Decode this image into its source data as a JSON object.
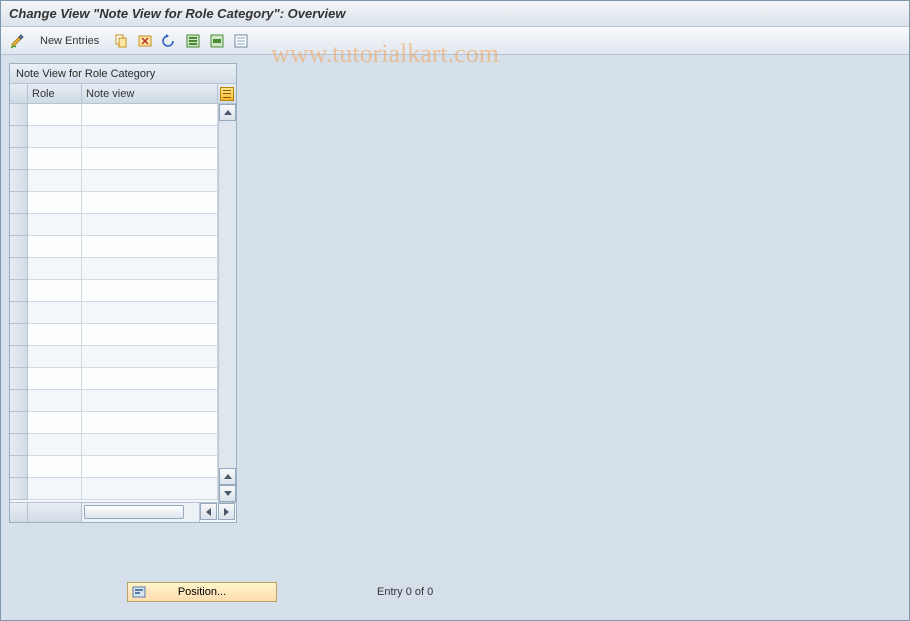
{
  "header": {
    "title": "Change View \"Note View for Role Category\": Overview"
  },
  "toolbar": {
    "edit_icon": "pencil-check",
    "new_entries_label": "New Entries",
    "btn_copy": "copy",
    "btn_delete": "delete",
    "btn_undo": "undo",
    "btn_select_all": "select-all",
    "btn_save": "save",
    "btn_deselect": "deselect-all"
  },
  "watermark": "www.tutorialkart.com",
  "panel": {
    "title": "Note View for Role Category",
    "columns": {
      "row_selector": "",
      "role": "Role",
      "note_view": "Note view",
      "config": ""
    },
    "rows": [
      {
        "role": "",
        "note_view": ""
      },
      {
        "role": "",
        "note_view": ""
      },
      {
        "role": "",
        "note_view": ""
      },
      {
        "role": "",
        "note_view": ""
      },
      {
        "role": "",
        "note_view": ""
      },
      {
        "role": "",
        "note_view": ""
      },
      {
        "role": "",
        "note_view": ""
      },
      {
        "role": "",
        "note_view": ""
      },
      {
        "role": "",
        "note_view": ""
      },
      {
        "role": "",
        "note_view": ""
      },
      {
        "role": "",
        "note_view": ""
      },
      {
        "role": "",
        "note_view": ""
      },
      {
        "role": "",
        "note_view": ""
      },
      {
        "role": "",
        "note_view": ""
      },
      {
        "role": "",
        "note_view": ""
      },
      {
        "role": "",
        "note_view": ""
      },
      {
        "role": "",
        "note_view": ""
      },
      {
        "role": "",
        "note_view": ""
      }
    ]
  },
  "footer": {
    "position_label": "Position...",
    "entry_text": "Entry 0 of 0"
  }
}
